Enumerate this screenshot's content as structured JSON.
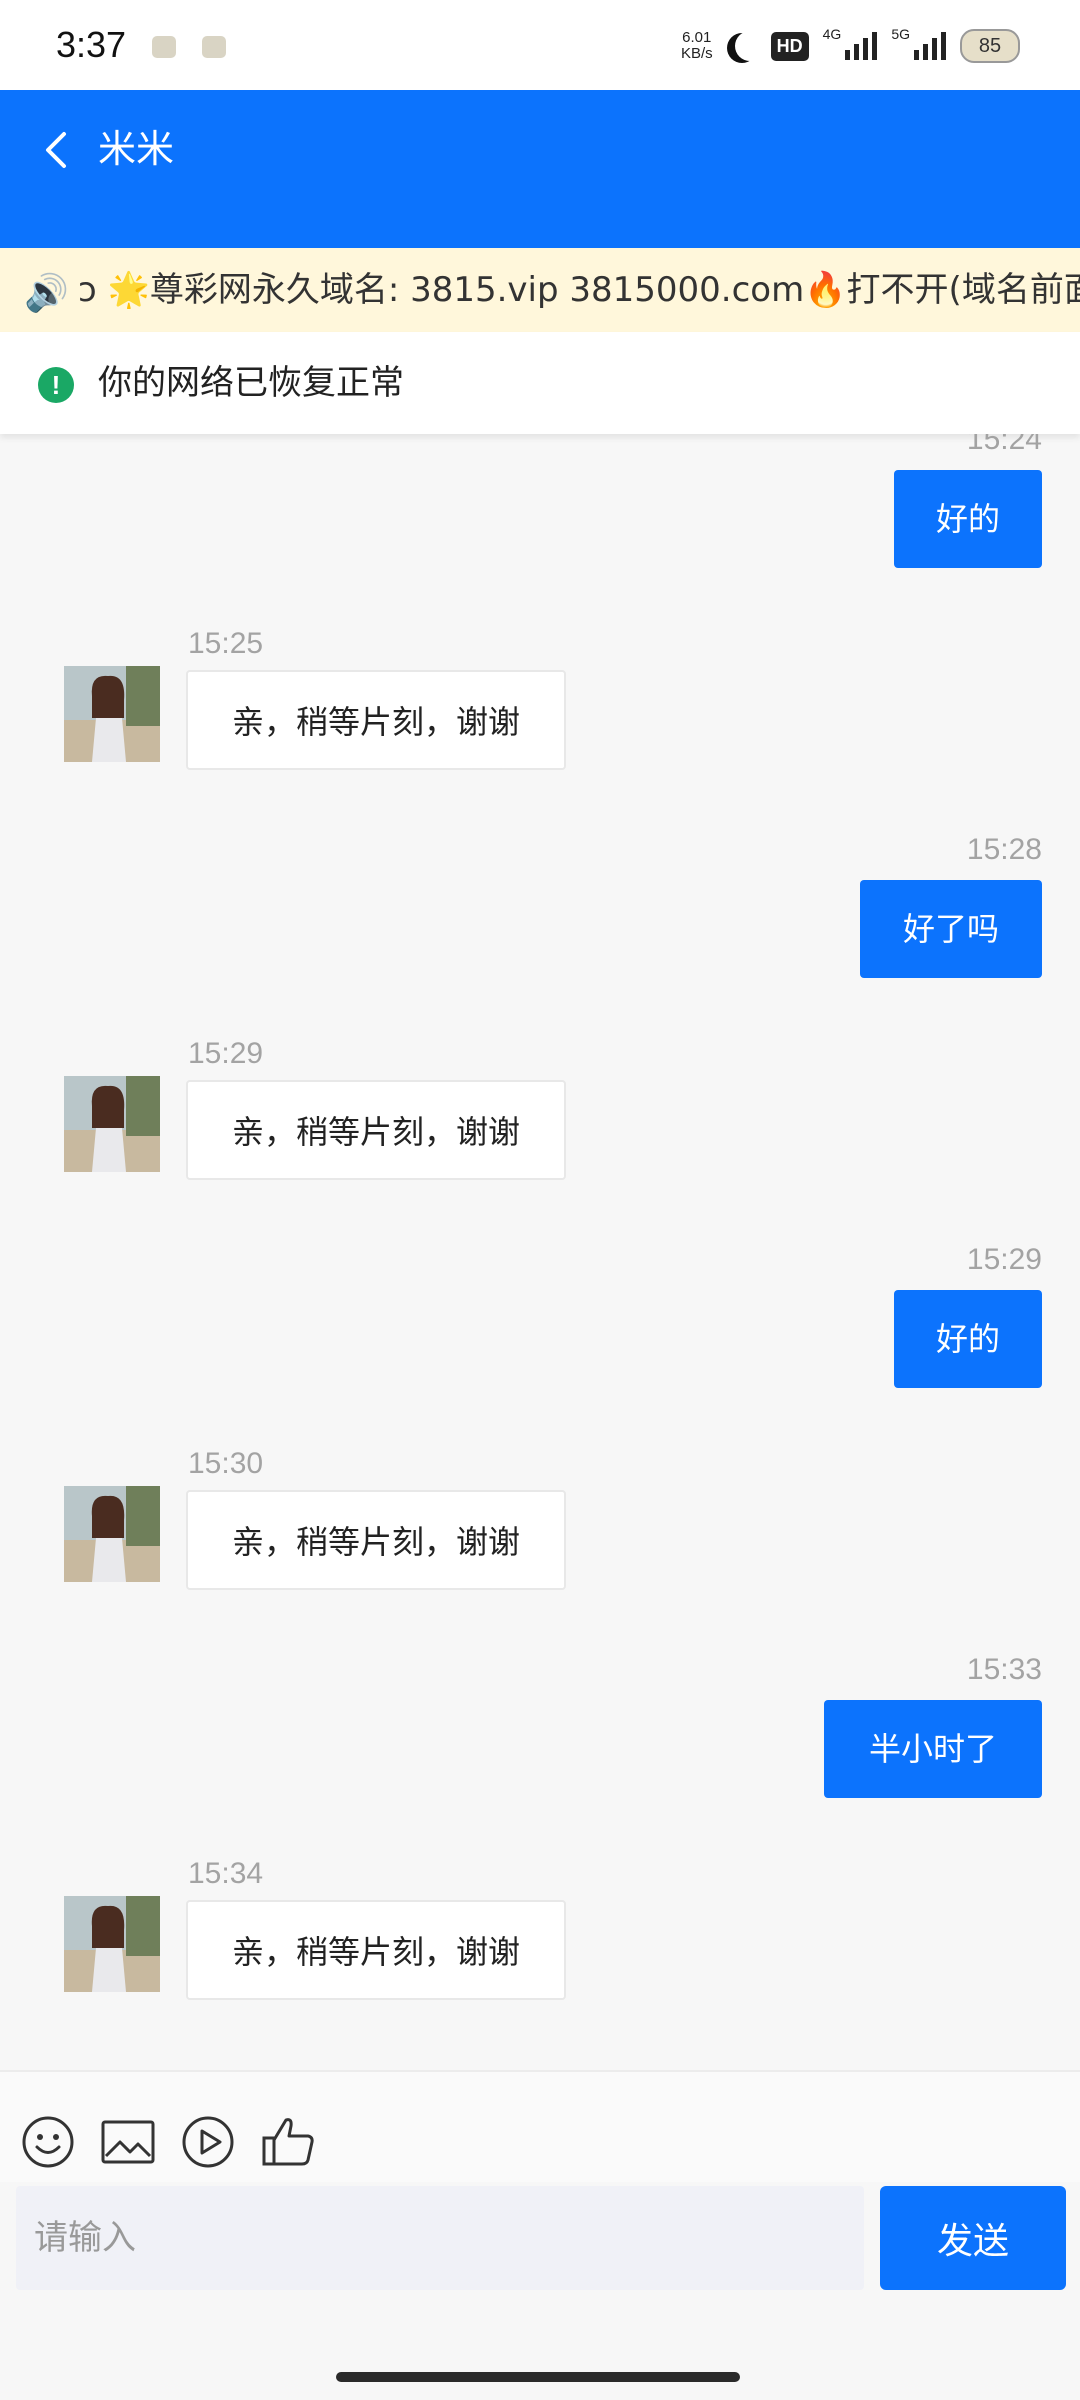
{
  "status_bar": {
    "time": "3:37",
    "net_speed_value": "6.01",
    "net_speed_unit": "KB/s",
    "hd_label": "HD",
    "net_4g": "4G",
    "net_5g": "5G",
    "battery": "85"
  },
  "header": {
    "title": "米米"
  },
  "notice": {
    "text": "ↄ 🌟尊彩网永久域名: 3815.vip 3815000.com🔥打不开(域名前面"
  },
  "network_status": {
    "text": "你的网络已恢复正常"
  },
  "messages": [
    {
      "dir": "out",
      "time": "15:24",
      "text": "好的"
    },
    {
      "dir": "in",
      "time": "15:25",
      "text": "亲，稍等片刻，谢谢"
    },
    {
      "dir": "out",
      "time": "15:28",
      "text": "好了吗"
    },
    {
      "dir": "in",
      "time": "15:29",
      "text": "亲，稍等片刻，谢谢"
    },
    {
      "dir": "out",
      "time": "15:29",
      "text": "好的"
    },
    {
      "dir": "in",
      "time": "15:30",
      "text": "亲，稍等片刻，谢谢"
    },
    {
      "dir": "out",
      "time": "15:33",
      "text": "半小时了"
    },
    {
      "dir": "in",
      "time": "15:34",
      "text": "亲，稍等片刻，谢谢"
    }
  ],
  "composer": {
    "placeholder": "请输入",
    "send_label": "发送",
    "tools": [
      "emoji-icon",
      "image-icon",
      "video-icon",
      "thumbs-up-icon"
    ]
  },
  "colors": {
    "primary": "#0c73fd",
    "notice_bg": "#fff7db",
    "success": "#1aa865"
  }
}
